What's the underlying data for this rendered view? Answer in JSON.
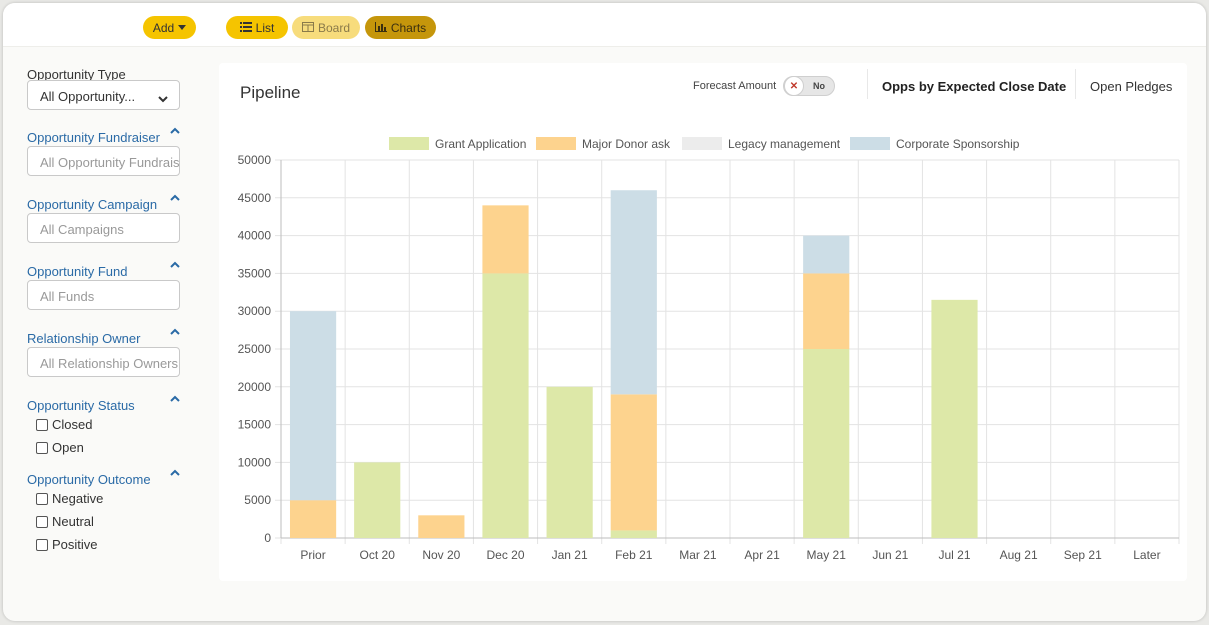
{
  "toolbar": {
    "add_label": "Add",
    "list_label": "List",
    "board_label": "Board",
    "charts_label": "Charts"
  },
  "filters": {
    "type": {
      "label": "Opportunity Type",
      "value": "All Opportunity..."
    },
    "fundraiser": {
      "label": "Opportunity Fundraiser",
      "placeholder": "All Opportunity Fundraisers"
    },
    "campaign": {
      "label": "Opportunity Campaign",
      "placeholder": "All Campaigns"
    },
    "fund": {
      "label": "Opportunity Fund",
      "placeholder": "All Funds"
    },
    "owner": {
      "label": "Relationship Owner",
      "placeholder": "All Relationship Owners"
    },
    "status": {
      "label": "Opportunity Status",
      "options": [
        "Closed",
        "Open"
      ]
    },
    "outcome": {
      "label": "Opportunity Outcome",
      "options": [
        "Negative",
        "Neutral",
        "Positive"
      ]
    }
  },
  "panel": {
    "title": "Pipeline",
    "forecast_label": "Forecast Amount",
    "toggle_value": "No",
    "tabs": [
      "Opps by Expected Close Date",
      "Open Pledges"
    ]
  },
  "colors": {
    "grant": "#dde8a8",
    "major": "#fdd38e",
    "legacy": "#ececec",
    "corporate": "#ccdde6"
  },
  "chart_data": {
    "type": "bar",
    "stacked": true,
    "categories": [
      "Prior",
      "Oct 20",
      "Nov 20",
      "Dec 20",
      "Jan 21",
      "Feb 21",
      "Mar 21",
      "Apr 21",
      "May 21",
      "Jun 21",
      "Jul 21",
      "Aug 21",
      "Sep 21",
      "Later"
    ],
    "series": [
      {
        "name": "Grant Application",
        "values": [
          0,
          10000,
          0,
          35000,
          20000,
          1000,
          0,
          0,
          25000,
          0,
          31500,
          0,
          0,
          0
        ]
      },
      {
        "name": "Major Donor ask",
        "values": [
          5000,
          0,
          3000,
          9000,
          0,
          18000,
          0,
          0,
          10000,
          0,
          0,
          0,
          0,
          0
        ]
      },
      {
        "name": "Legacy management",
        "values": [
          0,
          0,
          0,
          0,
          0,
          0,
          0,
          0,
          0,
          0,
          0,
          0,
          0,
          0
        ]
      },
      {
        "name": "Corporate Sponsorship",
        "values": [
          25000,
          0,
          0,
          0,
          0,
          27000,
          0,
          0,
          5000,
          0,
          0,
          0,
          0,
          0
        ]
      }
    ],
    "yticks": [
      "0",
      "5000",
      "10000",
      "15000",
      "20000",
      "25000",
      "30000",
      "35000",
      "40000",
      "45000",
      "50000"
    ],
    "ylim": [
      0,
      50000
    ],
    "grid": true,
    "legend": "top"
  }
}
